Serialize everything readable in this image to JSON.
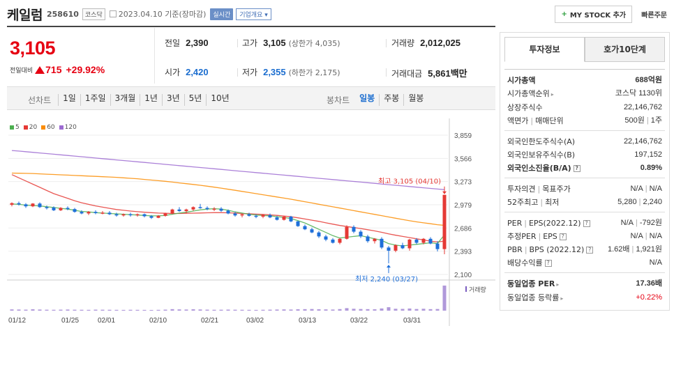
{
  "header": {
    "name": "케일럼",
    "code": "258610",
    "market": "코스닥",
    "date_text": "2023.04.10 기준(장마감)",
    "realtime": "실시간",
    "company_info": "기업개요",
    "mystock": "MY STOCK 추가",
    "quick_order": "빠른주문"
  },
  "price": {
    "current": "3,105",
    "change_label": "전일대비",
    "change_amount": "715",
    "change_pct": "+29.92%"
  },
  "stats": {
    "prev_close_label": "전일",
    "prev_close": "2,390",
    "high_label": "고가",
    "high": "3,105",
    "upper_limit": "(상한가 4,035)",
    "volume_label": "거래량",
    "volume": "2,012,025",
    "open_label": "시가",
    "open": "2,420",
    "low_label": "저가",
    "low": "2,355",
    "lower_limit": "(하한가 2,175)",
    "amount_label": "거래대금",
    "amount": "5,861",
    "amount_unit": "백만"
  },
  "periods": {
    "line_label": "선차트",
    "line_items": [
      "1일",
      "1주일",
      "3개월",
      "1년",
      "3년",
      "5년",
      "10년"
    ],
    "candle_label": "봉차트",
    "candle_items": [
      "일봉",
      "주봉",
      "월봉"
    ],
    "active_candle": "일봉"
  },
  "chart_data": {
    "type": "line",
    "legend": [
      {
        "name": "5",
        "color": "#4caf50"
      },
      {
        "name": "20",
        "color": "#e53935"
      },
      {
        "name": "60",
        "color": "#fb8c00"
      },
      {
        "name": "120",
        "color": "#9c6ad1"
      }
    ],
    "y_ticks": [
      "3,859",
      "3,566",
      "3,273",
      "2,979",
      "2,686",
      "2,393",
      "2,100"
    ],
    "ylim": [
      2100,
      3859
    ],
    "x_ticks": [
      "01/12",
      "01/25",
      "02/01",
      "02/10",
      "02/21",
      "03/02",
      "03/13",
      "03/22",
      "03/31"
    ],
    "high_annotation": "최고 3,105 (04/10)",
    "low_annotation": "최저 2,240 (03/27)",
    "volume_label": "거래량",
    "candles": [
      [
        2980,
        3010,
        2960,
        3000
      ],
      [
        3000,
        3020,
        2970,
        2985
      ],
      [
        2985,
        3000,
        2940,
        2960
      ],
      [
        2960,
        3000,
        2950,
        2995
      ],
      [
        2995,
        3010,
        2940,
        2950
      ],
      [
        2950,
        2970,
        2920,
        2945
      ],
      [
        2945,
        2960,
        2900,
        2910
      ],
      [
        2910,
        2950,
        2900,
        2940
      ],
      [
        2940,
        2960,
        2910,
        2925
      ],
      [
        2925,
        2940,
        2880,
        2890
      ],
      [
        2890,
        2910,
        2860,
        2870
      ],
      [
        2870,
        2900,
        2850,
        2890
      ],
      [
        2890,
        2910,
        2860,
        2875
      ],
      [
        2875,
        2900,
        2860,
        2880
      ],
      [
        2880,
        2900,
        2850,
        2860
      ],
      [
        2860,
        2880,
        2830,
        2845
      ],
      [
        2845,
        2870,
        2830,
        2860
      ],
      [
        2860,
        2880,
        2830,
        2850
      ],
      [
        2850,
        2870,
        2830,
        2860
      ],
      [
        2860,
        2870,
        2820,
        2835
      ],
      [
        2835,
        2850,
        2800,
        2815
      ],
      [
        2815,
        2850,
        2810,
        2840
      ],
      [
        2840,
        2880,
        2830,
        2870
      ],
      [
        2870,
        2930,
        2860,
        2920
      ],
      [
        2920,
        2950,
        2890,
        2900
      ],
      [
        2900,
        2930,
        2870,
        2920
      ],
      [
        2920,
        2960,
        2900,
        2950
      ],
      [
        2950,
        2990,
        2930,
        2940
      ],
      [
        2940,
        2960,
        2910,
        2925
      ],
      [
        2925,
        2950,
        2900,
        2930
      ],
      [
        2930,
        2950,
        2890,
        2905
      ],
      [
        2905,
        2920,
        2860,
        2870
      ],
      [
        2870,
        2890,
        2830,
        2845
      ],
      [
        2845,
        2870,
        2820,
        2860
      ],
      [
        2860,
        2880,
        2830,
        2840
      ],
      [
        2840,
        2860,
        2810,
        2830
      ],
      [
        2830,
        2860,
        2810,
        2850
      ],
      [
        2850,
        2870,
        2810,
        2820
      ],
      [
        2820,
        2840,
        2780,
        2790
      ],
      [
        2790,
        2840,
        2780,
        2830
      ],
      [
        2830,
        2840,
        2760,
        2770
      ],
      [
        2770,
        2780,
        2700,
        2710
      ],
      [
        2710,
        2730,
        2660,
        2670
      ],
      [
        2670,
        2690,
        2620,
        2630
      ],
      [
        2630,
        2650,
        2560,
        2580
      ],
      [
        2580,
        2600,
        2520,
        2540
      ],
      [
        2540,
        2560,
        2490,
        2500
      ],
      [
        2500,
        2560,
        2480,
        2550
      ],
      [
        2550,
        2720,
        2540,
        2700
      ],
      [
        2700,
        2720,
        2620,
        2640
      ],
      [
        2640,
        2660,
        2560,
        2580
      ],
      [
        2580,
        2600,
        2500,
        2520
      ],
      [
        2520,
        2560,
        2490,
        2550
      ],
      [
        2550,
        2570,
        2420,
        2440
      ],
      [
        2440,
        2460,
        2240,
        2400
      ],
      [
        2400,
        2480,
        2380,
        2470
      ],
      [
        2470,
        2500,
        2420,
        2430
      ],
      [
        2430,
        2550,
        2400,
        2540
      ],
      [
        2540,
        2560,
        2480,
        2500
      ],
      [
        2500,
        2560,
        2480,
        2550
      ],
      [
        2550,
        2570,
        2480,
        2490
      ],
      [
        2490,
        2520,
        2390,
        2420
      ],
      [
        2420,
        3105,
        2355,
        3105
      ]
    ],
    "ma5": [
      2990,
      2985,
      2975,
      2970,
      2965,
      2955,
      2945,
      2935,
      2925,
      2910,
      2895,
      2890,
      2880,
      2875,
      2870,
      2865,
      2860,
      2855,
      2850,
      2845,
      2840,
      2840,
      2845,
      2860,
      2875,
      2885,
      2900,
      2915,
      2925,
      2930,
      2925,
      2910,
      2890,
      2875,
      2860,
      2850,
      2845,
      2840,
      2830,
      2820,
      2805,
      2780,
      2750,
      2710,
      2670,
      2630,
      2590,
      2560,
      2570,
      2580,
      2590,
      2570,
      2550,
      2530,
      2490,
      2470,
      2460,
      2470,
      2480,
      2490,
      2500,
      2490,
      2600
    ],
    "ma20": [
      3360,
      3320,
      3280,
      3240,
      3200,
      3160,
      3120,
      3090,
      3060,
      3030,
      3005,
      2985,
      2965,
      2950,
      2935,
      2920,
      2910,
      2900,
      2892,
      2885,
      2880,
      2875,
      2872,
      2870,
      2870,
      2872,
      2874,
      2876,
      2878,
      2880,
      2880,
      2878,
      2874,
      2870,
      2866,
      2862,
      2858,
      2852,
      2846,
      2838,
      2828,
      2815,
      2800,
      2785,
      2770,
      2752,
      2735,
      2718,
      2705,
      2692,
      2680,
      2665,
      2650,
      2632,
      2612,
      2595,
      2580,
      2565,
      2550,
      2535,
      2520,
      2510,
      2520
    ],
    "ma60": [
      3380,
      3378,
      3376,
      3374,
      3370,
      3366,
      3362,
      3358,
      3354,
      3350,
      3346,
      3342,
      3338,
      3334,
      3330,
      3326,
      3320,
      3314,
      3308,
      3300,
      3292,
      3284,
      3276,
      3266,
      3256,
      3246,
      3236,
      3226,
      3214,
      3202,
      3190,
      3176,
      3162,
      3148,
      3134,
      3120,
      3106,
      3092,
      3078,
      3064,
      3050,
      3034,
      3018,
      3002,
      2986,
      2970,
      2954,
      2938,
      2922,
      2906,
      2890,
      2874,
      2858,
      2842,
      2826,
      2810,
      2794,
      2778,
      2764,
      2752,
      2740,
      2728,
      2720
    ],
    "ma120": [
      3665,
      3658,
      3650,
      3642,
      3634,
      3626,
      3618,
      3610,
      3602,
      3594,
      3586,
      3578,
      3570,
      3562,
      3554,
      3546,
      3538,
      3530,
      3522,
      3514,
      3506,
      3498,
      3490,
      3482,
      3474,
      3466,
      3458,
      3450,
      3442,
      3434,
      3426,
      3418,
      3410,
      3402,
      3394,
      3386,
      3378,
      3370,
      3362,
      3354,
      3346,
      3338,
      3330,
      3322,
      3314,
      3306,
      3298,
      3290,
      3282,
      3274,
      3266,
      3258,
      3250,
      3242,
      3234,
      3226,
      3218,
      3210,
      3202,
      3194,
      3186,
      3178,
      3170
    ],
    "volume": [
      20,
      18,
      16,
      22,
      18,
      15,
      14,
      16,
      18,
      15,
      14,
      13,
      16,
      15,
      14,
      13,
      12,
      14,
      13,
      12,
      11,
      13,
      16,
      24,
      20,
      18,
      22,
      19,
      16,
      14,
      15,
      17,
      15,
      14,
      13,
      12,
      14,
      16,
      18,
      20,
      18,
      22,
      24,
      26,
      22,
      20,
      18,
      25,
      40,
      30,
      26,
      24,
      22,
      35,
      55,
      30,
      28,
      34,
      26,
      30,
      24,
      26,
      400
    ]
  },
  "right_panel": {
    "tab_active": "투자정보",
    "tab_other": "호가10단계",
    "market_cap_label": "시가총액",
    "market_cap": "688억원",
    "market_cap_rank_label": "시가총액순위",
    "market_cap_rank": "코스닥 1130위",
    "listed_shares_label": "상장주식수",
    "listed_shares": "22,146,762",
    "par_label": "액면가",
    "trade_unit_label": "매매단위",
    "par_value": "500원",
    "trade_unit": "1주",
    "foreign_limit_label": "외국인한도주식수(A)",
    "foreign_limit": "22,146,762",
    "foreign_hold_label": "외국인보유주식수(B)",
    "foreign_hold": "197,152",
    "foreign_ratio_label": "외국인소진율(B/A)",
    "foreign_ratio": "0.89%",
    "opinion_label": "투자의견",
    "target_label": "목표주가",
    "opinion": "N/A",
    "target": "N/A",
    "w52_high_label": "52주최고",
    "w52_low_label": "최저",
    "w52_high": "5,280",
    "w52_low": "2,240",
    "per_label": "PER",
    "eps_label": "EPS(2022.12)",
    "per": "N/A",
    "eps": "-792원",
    "est_per_label": "추정PER",
    "est_eps_label": "EPS",
    "est_per": "N/A",
    "est_eps": "N/A",
    "pbr_label": "PBR",
    "bps_label": "BPS (2022.12)",
    "pbr": "1.62배",
    "bps": "1,921원",
    "dividend_label": "배당수익률",
    "dividend": "N/A",
    "sector_per_label": "동일업종 PER",
    "sector_per": "17.36배",
    "sector_change_label": "동일업종 등락률",
    "sector_change": "+0.22%"
  }
}
